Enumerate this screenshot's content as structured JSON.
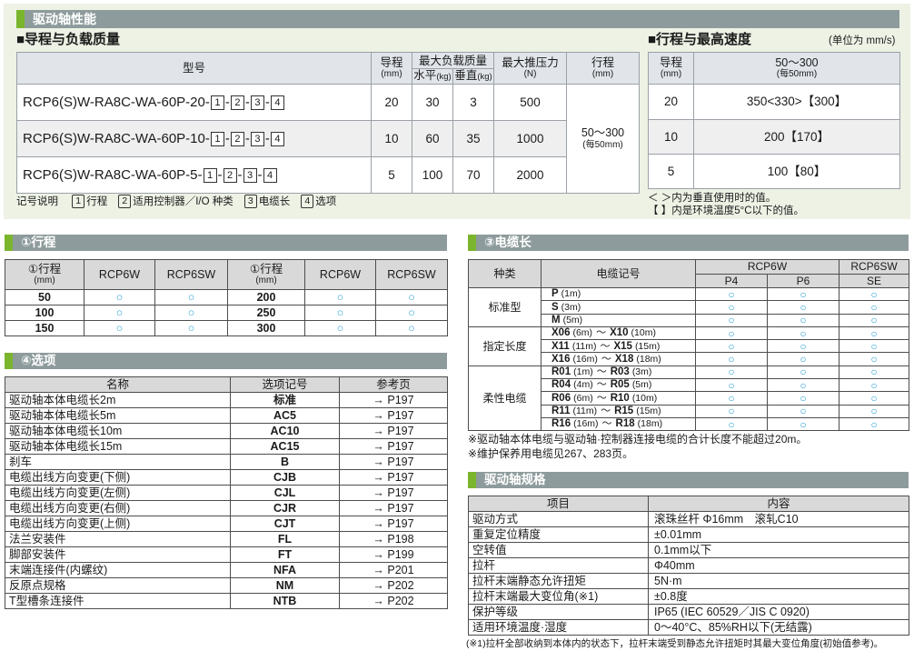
{
  "colors": {
    "panel_bg": "#edf2e5",
    "section_bar": "#8e9b9c",
    "section_tab": "#7ab52d",
    "top_header_bg": "#e1e5ea",
    "table_header_bg": "#d9d9d9",
    "availability_mark": "#2a9fd6"
  },
  "performance": {
    "title": "驱动轴性能",
    "lead_load": {
      "heading": "■导程与负载质量",
      "headers": {
        "model": "型号",
        "lead": "导程",
        "lead_unit": "(mm)",
        "max_load": "最大负载质量",
        "horizontal": "水平",
        "horizontal_unit": "(kg)",
        "vertical": "垂直",
        "vertical_unit": "(kg)",
        "max_push": "最大推压力",
        "max_push_unit": "(N)",
        "stroke": "行程",
        "stroke_unit": "(mm)"
      },
      "separator": "-",
      "rows": [
        {
          "model_prefix": "RCP6(S)W-RA8C-WA-60P-20-",
          "option_codes": [
            "1",
            "2",
            "3",
            "4"
          ],
          "lead": "20",
          "horizontal": "30",
          "vertical": "3",
          "push": "500"
        },
        {
          "model_prefix": "RCP6(S)W-RA8C-WA-60P-10-",
          "option_codes": [
            "1",
            "2",
            "3",
            "4"
          ],
          "lead": "10",
          "horizontal": "60",
          "vertical": "35",
          "push": "1000"
        },
        {
          "model_prefix": "RCP6(S)W-RA8C-WA-60P-5-",
          "option_codes": [
            "1",
            "2",
            "3",
            "4"
          ],
          "lead": "5",
          "horizontal": "100",
          "vertical": "70",
          "push": "2000"
        }
      ],
      "stroke_value": "50～300",
      "stroke_note": "(每50mm)"
    },
    "speed": {
      "heading": "■行程与最高速度",
      "unit_note": "(单位为 mm/s)",
      "headers": {
        "lead": "导程",
        "lead_unit": "(mm)",
        "stroke": "50～300",
        "stroke_note": "(每50mm)"
      },
      "rows": [
        {
          "lead": "20",
          "speed": "350<330>【300】"
        },
        {
          "lead": "10",
          "speed": "200【170】"
        },
        {
          "lead": "5",
          "speed": "100【80】"
        }
      ]
    },
    "legend": {
      "label": "记号说明",
      "items": [
        {
          "num": "1",
          "text": "行程"
        },
        {
          "num": "2",
          "text": "适用控制器／I/O 种类"
        },
        {
          "num": "3",
          "text": "电缆长"
        },
        {
          "num": "4",
          "text": "选项"
        }
      ]
    },
    "notes": [
      "＜ ＞内为垂直使用时的值。",
      "【 】内是环境温度5°C以下的值。"
    ]
  },
  "stroke": {
    "title": "①行程",
    "headers": {
      "stroke": "①行程",
      "stroke_unit": "(mm)",
      "rcp6w": "RCP6W",
      "rcp6sw": "RCP6SW"
    },
    "rows": [
      [
        "50",
        "○",
        "○",
        "200",
        "○",
        "○"
      ],
      [
        "100",
        "○",
        "○",
        "250",
        "○",
        "○"
      ],
      [
        "150",
        "○",
        "○",
        "300",
        "○",
        "○"
      ]
    ]
  },
  "options": {
    "title": "④选项",
    "headers": {
      "name": "名称",
      "code": "选项记号",
      "page": "参考页"
    },
    "rows": [
      {
        "name": "驱动轴本体电缆长2m",
        "code": "标准",
        "page": "→ P197"
      },
      {
        "name": "驱动轴本体电缆长5m",
        "code": "AC5",
        "page": "→ P197"
      },
      {
        "name": "驱动轴本体电缆长10m",
        "code": "AC10",
        "page": "→ P197"
      },
      {
        "name": "驱动轴本体电缆长15m",
        "code": "AC15",
        "page": "→ P197"
      },
      {
        "name": "刹车",
        "code": "B",
        "page": "→ P197"
      },
      {
        "name": "电缆出线方向变更(下侧)",
        "code": "CJB",
        "page": "→ P197"
      },
      {
        "name": "电缆出线方向变更(左侧)",
        "code": "CJL",
        "page": "→ P197"
      },
      {
        "name": "电缆出线方向变更(右侧)",
        "code": "CJR",
        "page": "→ P197"
      },
      {
        "name": "电缆出线方向变更(上侧)",
        "code": "CJT",
        "page": "→ P197"
      },
      {
        "name": "法兰安装件",
        "code": "FL",
        "page": "→ P198"
      },
      {
        "name": "脚部安装件",
        "code": "FT",
        "page": "→ P199"
      },
      {
        "name": "末端连接件(内螺纹)",
        "code": "NFA",
        "page": "→ P201"
      },
      {
        "name": "反原点规格",
        "code": "NM",
        "page": "→ P202"
      },
      {
        "name": "T型槽条连接件",
        "code": "NTB",
        "page": "→ P202"
      }
    ]
  },
  "cable": {
    "title": "③电缆长",
    "headers": {
      "type": "种类",
      "code": "电缆记号",
      "rcp6w": "RCP6W",
      "rcp6sw": "RCP6SW",
      "p4": "P4",
      "p6": "P6",
      "se": "SE"
    },
    "range_separator": "～",
    "groups": [
      {
        "type": "标准型",
        "rows": [
          {
            "codes": [
              {
                "code": "P",
                "length": "(1m)"
              }
            ],
            "marks": [
              "○",
              "○",
              "○"
            ]
          },
          {
            "codes": [
              {
                "code": "S",
                "length": "(3m)"
              }
            ],
            "marks": [
              "○",
              "○",
              "○"
            ]
          },
          {
            "codes": [
              {
                "code": "M",
                "length": "(5m)"
              }
            ],
            "marks": [
              "○",
              "○",
              "○"
            ]
          }
        ]
      },
      {
        "type": "指定长度",
        "rows": [
          {
            "codes": [
              {
                "code": "X06",
                "length": "(6m)"
              },
              {
                "code": "X10",
                "length": "(10m)"
              }
            ],
            "marks": [
              "○",
              "○",
              "○"
            ]
          },
          {
            "codes": [
              {
                "code": "X11",
                "length": "(11m)"
              },
              {
                "code": "X15",
                "length": "(15m)"
              }
            ],
            "marks": [
              "○",
              "○",
              "○"
            ]
          },
          {
            "codes": [
              {
                "code": "X16",
                "length": "(16m)"
              },
              {
                "code": "X18",
                "length": "(18m)"
              }
            ],
            "marks": [
              "○",
              "○",
              "○"
            ]
          }
        ]
      },
      {
        "type": "柔性电缆",
        "rows": [
          {
            "codes": [
              {
                "code": "R01",
                "length": "(1m)"
              },
              {
                "code": "R03",
                "length": "(3m)"
              }
            ],
            "marks": [
              "○",
              "○",
              "○"
            ]
          },
          {
            "codes": [
              {
                "code": "R04",
                "length": "(4m)"
              },
              {
                "code": "R05",
                "length": "(5m)"
              }
            ],
            "marks": [
              "○",
              "○",
              "○"
            ]
          },
          {
            "codes": [
              {
                "code": "R06",
                "length": "(6m)"
              },
              {
                "code": "R10",
                "length": "(10m)"
              }
            ],
            "marks": [
              "○",
              "○",
              "○"
            ]
          },
          {
            "codes": [
              {
                "code": "R11",
                "length": "(11m)"
              },
              {
                "code": "R15",
                "length": "(15m)"
              }
            ],
            "marks": [
              "○",
              "○",
              "○"
            ]
          },
          {
            "codes": [
              {
                "code": "R16",
                "length": "(16m)"
              },
              {
                "code": "R18",
                "length": "(18m)"
              }
            ],
            "marks": [
              "○",
              "○",
              "○"
            ]
          }
        ]
      }
    ],
    "notes": [
      "※驱动轴本体电缆与驱动轴·控制器连接电缆的合计长度不能超过20m。",
      "※维护保养用电缆见267、283页。"
    ]
  },
  "specs": {
    "title": "驱动轴规格",
    "headers": {
      "item": "项目",
      "content": "内容"
    },
    "rows": [
      {
        "item": "驱动方式",
        "content": "滚珠丝杆 Φ16mm　滚轧C10"
      },
      {
        "item": "重复定位精度",
        "content": "±0.01mm"
      },
      {
        "item": "空转值",
        "content": "0.1mm以下"
      },
      {
        "item": "拉杆",
        "content": "Φ40mm"
      },
      {
        "item": "拉杆末端静态允许扭矩",
        "content": "5N·m"
      },
      {
        "item": "拉杆末端最大变位角(※1)",
        "content": "±0.8度"
      },
      {
        "item": "保护等级",
        "content": "IP65 (IEC 60529／JIS C 0920)"
      },
      {
        "item": "适用环境温度·湿度",
        "content": "0～40°C、85%RH以下(无结露)"
      }
    ],
    "footnote": "(※1)拉杆全部收纳到本体内的状态下，拉杆末端受到静态允许扭矩时其最大变位角度(初始值参考)。"
  }
}
